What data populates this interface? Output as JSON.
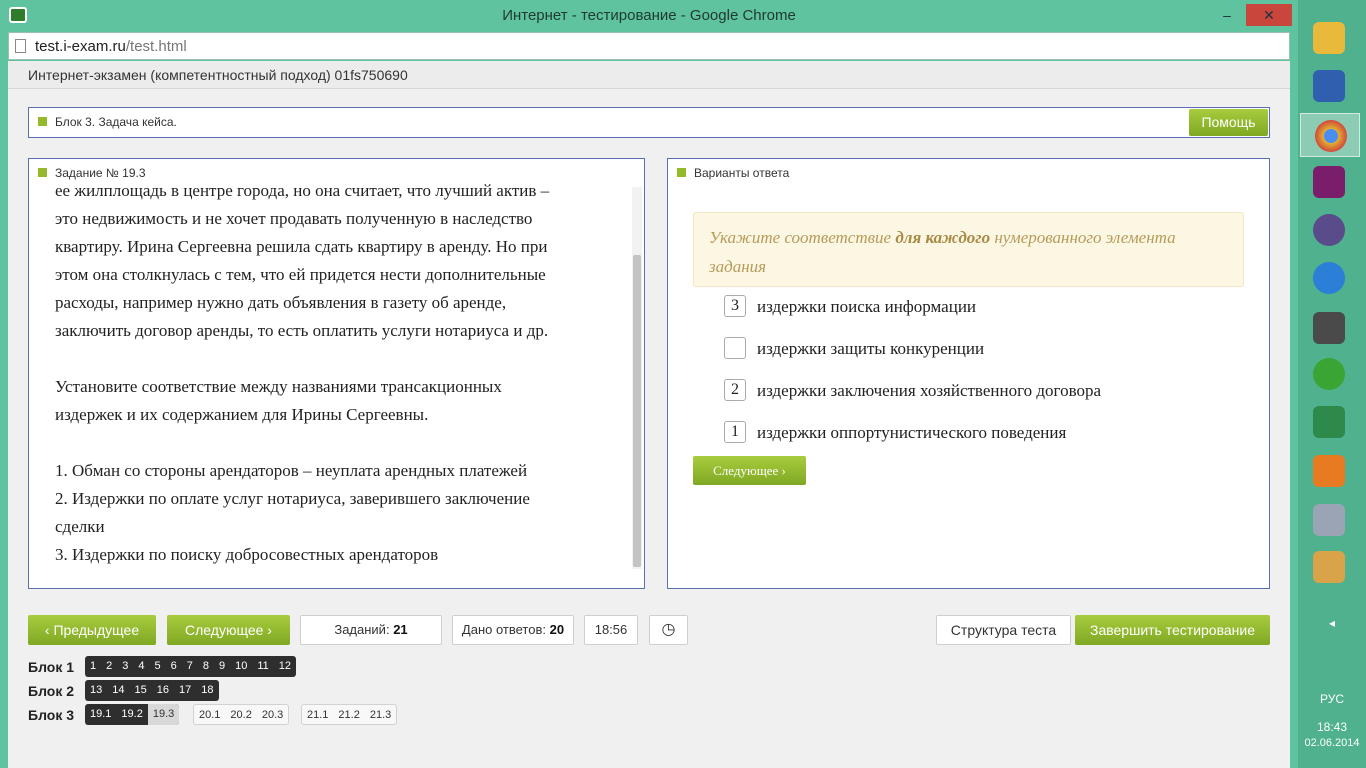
{
  "window": {
    "title": "Интернет - тестирование - Google Chrome",
    "controls": {
      "minimize": "–",
      "maximize": "□",
      "close": "✕"
    }
  },
  "address": {
    "host": "test.i-exam.ru",
    "path": "/test.html"
  },
  "page": {
    "header": "Интернет-экзамен (компетентностный подход) 01fs750690",
    "block_title": "Блок 3. Задача кейса.",
    "help_label": "Помощь"
  },
  "task": {
    "title": "Задание № 19.3",
    "lines": [
      "ее жилплощадь в центре города, но она считает, что лучший актив –",
      "это недвижимость и не хочет продавать полученную в наследство",
      "квартиру. Ирина Сергеевна решила сдать квартиру в аренду. Но при",
      "этом она столкнулась с тем, что ей придется нести дополнительные",
      "расходы, например нужно дать объявления в газету об аренде,",
      "заключить договор аренды, то есть оплатить услуги нотариуса и др.",
      "",
      "Установите соответствие между названиями трансакционных",
      "издержек и их содержанием для Ирины Сергеевны.",
      "",
      "1. Обман со стороны арендаторов – неуплата арендных платежей",
      "2. Издержки по оплате услуг нотариуса, заверившего заключение",
      "сделки",
      "3. Издержки по поиску добросовестных арендаторов"
    ]
  },
  "answers": {
    "title": "Варианты ответа",
    "instruction_pre": "Укажите соответствие ",
    "instruction_bold": "для каждого",
    "instruction_post": " нумерованного элемента задания",
    "items": [
      {
        "value": "3",
        "label": "издержки поиска информации"
      },
      {
        "value": "",
        "label": "издержки защиты конкуренции"
      },
      {
        "value": "2",
        "label": "издержки заключения хозяйственного договора"
      },
      {
        "value": "1",
        "label": "издержки оппортунистического поведения"
      }
    ],
    "next_label": "Следующее"
  },
  "controls": {
    "prev_label": "Предыдущее",
    "next_label": "Следующее",
    "tasks_label": "Заданий:",
    "tasks_count": "21",
    "answers_label": "Дано ответов:",
    "answers_count": "20",
    "timer": "18:56",
    "clock_icon": "◷",
    "structure_label": "Структура теста",
    "finish_label": "Завершить тестирование"
  },
  "navigation": {
    "block1": {
      "label": "Блок 1",
      "items": [
        "1",
        "2",
        "3",
        "4",
        "5",
        "6",
        "7",
        "8",
        "9",
        "10",
        "11",
        "12"
      ]
    },
    "block2": {
      "label": "Блок 2",
      "items": [
        "13",
        "14",
        "15",
        "16",
        "17",
        "18"
      ]
    },
    "block3": {
      "label": "Блок 3",
      "group1": [
        "19.1",
        "19.2",
        "19.3"
      ],
      "group2": [
        "20.1",
        "20.2",
        "20.3"
      ],
      "group3": [
        "21.1",
        "21.2",
        "21.3"
      ]
    }
  },
  "taskbar": {
    "lang": "РУС",
    "time": "18:43",
    "date": "02.06.2014",
    "arrow": "◂"
  }
}
